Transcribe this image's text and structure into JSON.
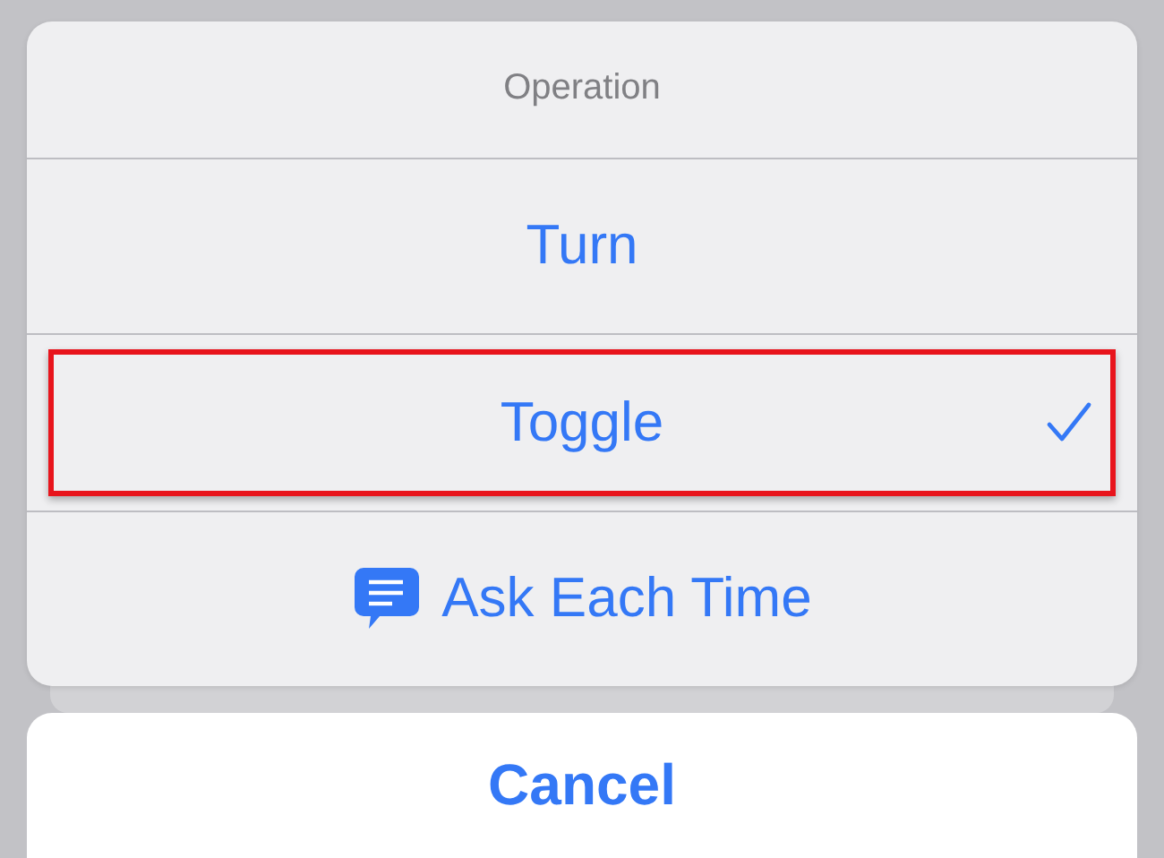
{
  "action_sheet": {
    "title": "Operation",
    "options": [
      {
        "label": "Turn",
        "kind": "plain",
        "selected": false,
        "highlighted": false
      },
      {
        "label": "Toggle",
        "kind": "plain",
        "selected": true,
        "highlighted": true
      },
      {
        "label": "Ask Each Time",
        "kind": "icon",
        "selected": false,
        "highlighted": false
      }
    ],
    "cancel": "Cancel"
  }
}
